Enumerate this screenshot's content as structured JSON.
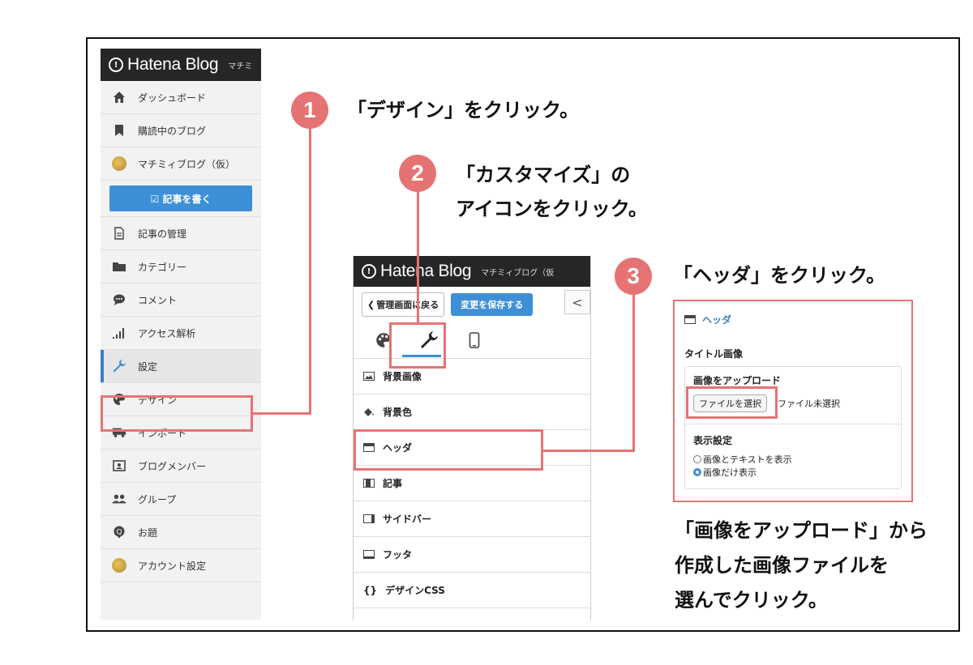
{
  "sidebar": {
    "logo": "Hatena Blog",
    "blog_name_short": "マチミ",
    "items": [
      {
        "label": "ダッシュボード",
        "icon": "home-icon"
      },
      {
        "label": "購読中のブログ",
        "icon": "bookmark-icon"
      },
      {
        "label": "マチミィブログ（仮）",
        "icon": "avatar-icon"
      }
    ],
    "write_button": "☑ 記事を書く",
    "items2": [
      {
        "label": "記事の管理",
        "icon": "document-icon"
      },
      {
        "label": "カテゴリー",
        "icon": "folder-icon"
      },
      {
        "label": "コメント",
        "icon": "comment-icon"
      },
      {
        "label": "アクセス解析",
        "icon": "chart-icon"
      },
      {
        "label": "設定",
        "icon": "wrench-icon"
      },
      {
        "label": "デザイン",
        "icon": "palette-icon"
      },
      {
        "label": "インポート",
        "icon": "truck-icon"
      },
      {
        "label": "ブログメンバー",
        "icon": "member-icon"
      },
      {
        "label": "グループ",
        "icon": "group-icon"
      },
      {
        "label": "お題",
        "icon": "topic-icon"
      },
      {
        "label": "アカウント設定",
        "icon": "avatar-icon"
      }
    ]
  },
  "customize": {
    "logo": "Hatena Blog",
    "blog_name": "マチミィブログ（仮",
    "back_button": "管理画面に戻る",
    "save_button": "変更を保存する",
    "collapse": "<",
    "tabs": [
      "palette-icon",
      "wrench-icon",
      "mobile-icon"
    ],
    "items": [
      {
        "label": "背景画像",
        "icon": "image-icon"
      },
      {
        "label": "背景色",
        "icon": "paint-bucket-icon"
      },
      {
        "label": "ヘッダ",
        "icon": "header-layout-icon"
      },
      {
        "label": "記事",
        "icon": "article-layout-icon"
      },
      {
        "label": "サイドバー",
        "icon": "sidebar-layout-icon"
      },
      {
        "label": "フッタ",
        "icon": "footer-layout-icon"
      },
      {
        "label": "デザインCSS",
        "icon": "code-icon"
      }
    ]
  },
  "header_panel": {
    "title": "ヘッダ",
    "title_image_label": "タイトル画像",
    "upload_label": "画像をアップロード",
    "file_button": "ファイルを選択",
    "file_status": "ファイル未選択",
    "display_label": "表示設定",
    "options": [
      {
        "label": "画像とテキストを表示",
        "selected": false
      },
      {
        "label": "画像だけ表示",
        "selected": true
      }
    ]
  },
  "steps": {
    "step1_num": "1",
    "step1_text": "「デザイン」をクリック。",
    "step2_num": "2",
    "step2_line1": "「カスタマイズ」の",
    "step2_line2": "アイコンをクリック。",
    "step3_num": "3",
    "step3_text": "「ヘッダ」をクリック。",
    "note_line1": "「画像をアップロード」から",
    "note_line2": "作成した画像ファイルを",
    "note_line3": "選んでクリック。"
  },
  "colors": {
    "accent": "#e57373",
    "blue": "#3d8fd6",
    "header": "#262626"
  }
}
